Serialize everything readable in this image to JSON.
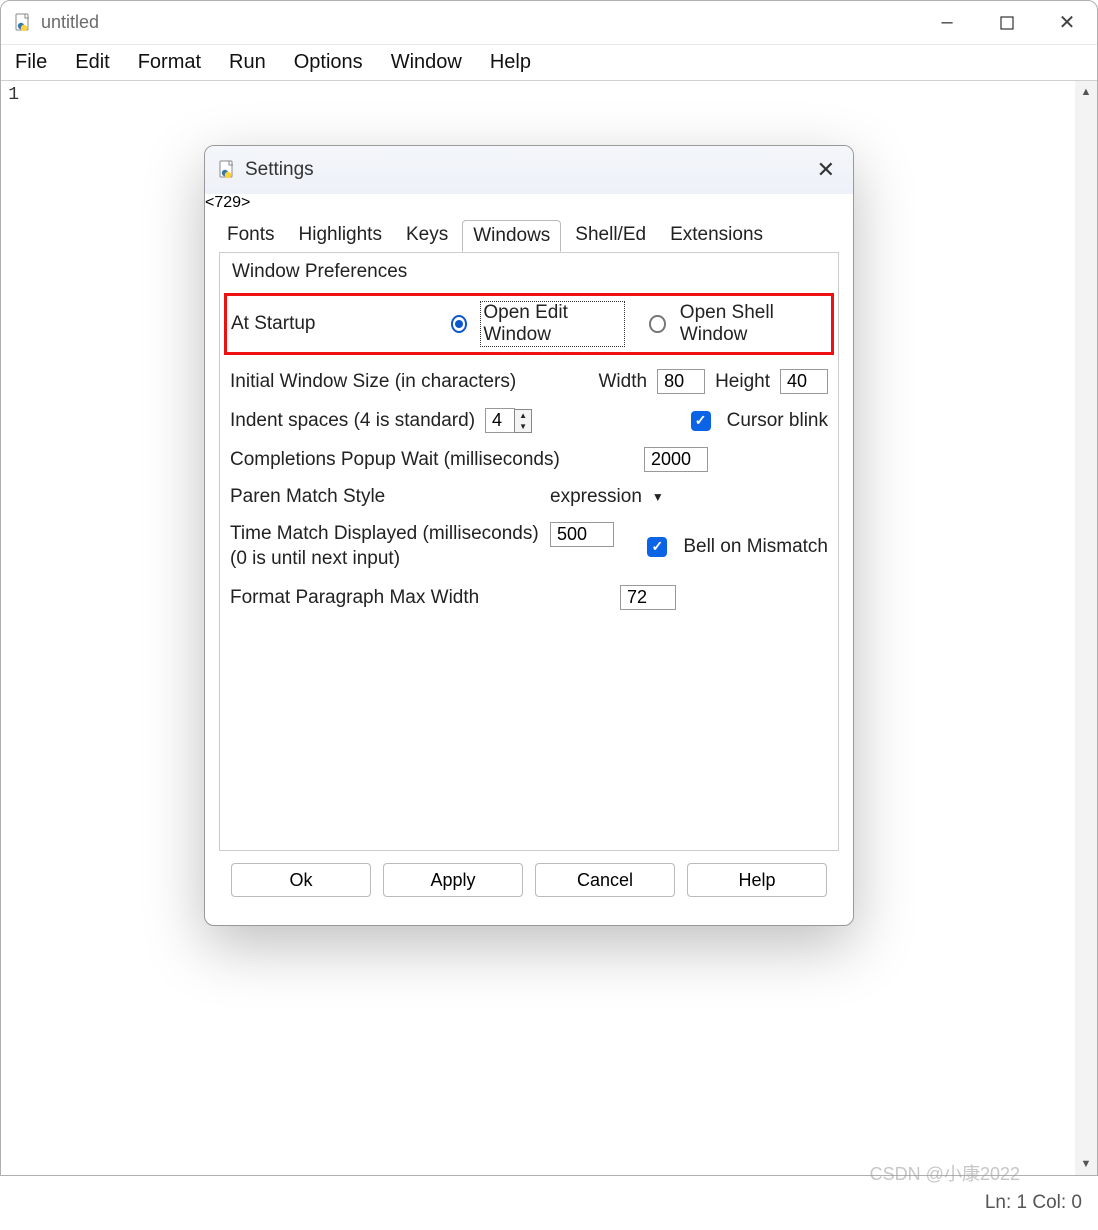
{
  "window": {
    "title": "untitled"
  },
  "menu": {
    "file": "File",
    "edit": "Edit",
    "format": "Format",
    "run": "Run",
    "options": "Options",
    "window_": "Window",
    "help": "Help"
  },
  "gutter": {
    "line1": "1"
  },
  "dialog": {
    "title": "Settings",
    "tabs": {
      "fonts": "Fonts",
      "highlights": "Highlights",
      "keys": "Keys",
      "windows": "Windows",
      "shelled": "Shell/Ed",
      "extensions": "Extensions",
      "active": "windows"
    },
    "legend": "Window Preferences",
    "startup": {
      "label": "At Startup",
      "opt_edit": "Open Edit Window",
      "opt_shell": "Open Shell Window",
      "selected": "edit"
    },
    "size": {
      "label": "Initial Window Size  (in characters)",
      "width_label": "Width",
      "width": "80",
      "height_label": "Height",
      "height": "40"
    },
    "indent": {
      "label": "Indent spaces (4 is standard)",
      "value": "4"
    },
    "cursor_blink": {
      "label": "Cursor blink",
      "checked": true
    },
    "completions": {
      "label": "Completions Popup Wait (milliseconds)",
      "value": "2000"
    },
    "paren": {
      "label": "Paren Match Style",
      "value": "expression"
    },
    "time_match": {
      "label1": "Time Match Displayed (milliseconds)",
      "label2": "(0 is until next input)",
      "value": "500"
    },
    "bell": {
      "label": "Bell on Mismatch",
      "checked": true
    },
    "format_width": {
      "label": "Format Paragraph Max Width",
      "value": "72"
    },
    "buttons": {
      "ok": "Ok",
      "apply": "Apply",
      "cancel": "Cancel",
      "help": "Help"
    }
  },
  "status": {
    "text": "Ln: 1 Col: 0"
  },
  "watermark": "CSDN @小康2022"
}
